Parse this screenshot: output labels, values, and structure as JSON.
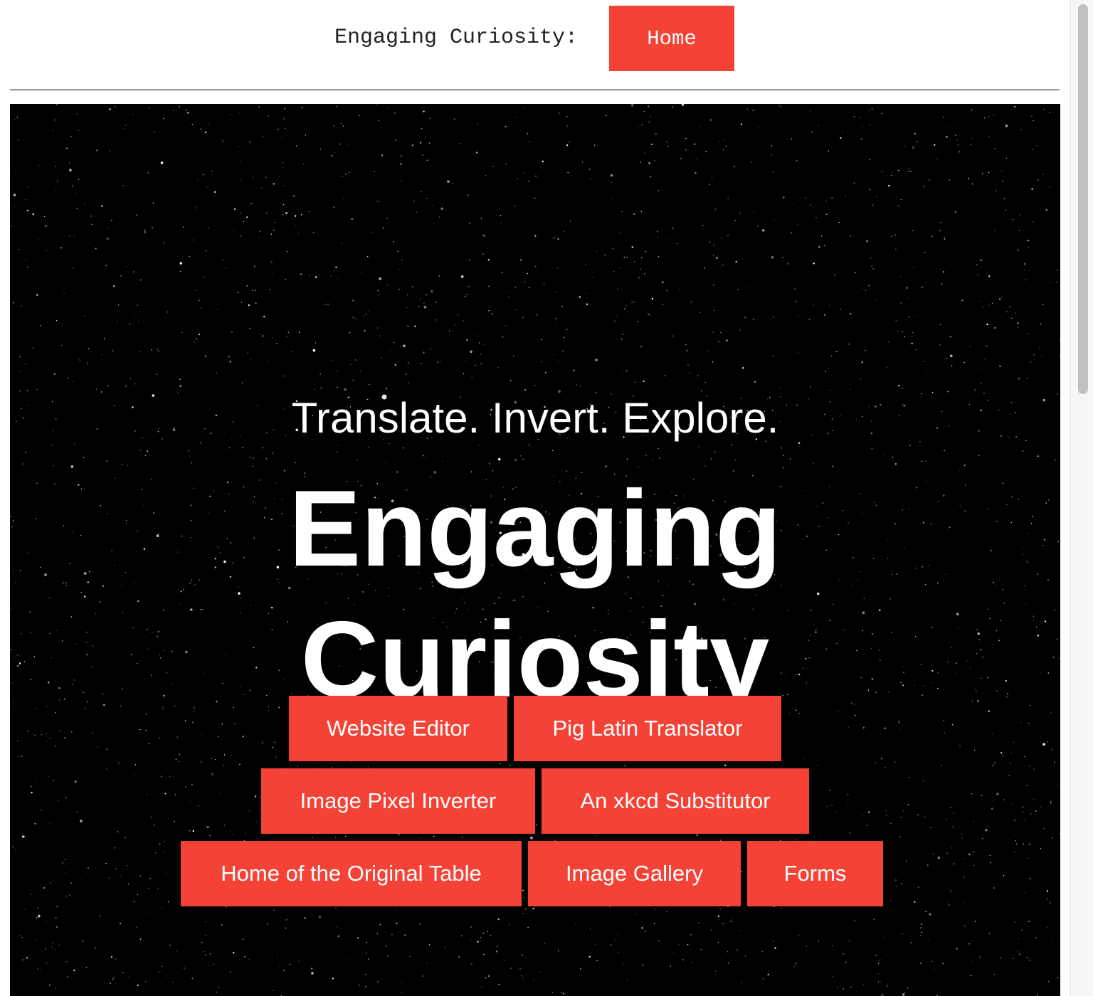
{
  "header": {
    "brand": "Engaging Curiosity:",
    "home_label": "Home"
  },
  "hero": {
    "tagline": "Translate. Invert. Explore.",
    "title_line1": "Engaging",
    "title_line2": "Curiosity",
    "buttons": [
      "Website Editor",
      "Pig Latin Translator",
      "Image Pixel Inverter",
      "An xkcd Substitutor",
      "Home of the Original Table",
      "Image Gallery",
      "Forms"
    ]
  },
  "colors": {
    "accent": "#f44336",
    "hero_background": "#000000",
    "text_light": "#ffffff"
  }
}
